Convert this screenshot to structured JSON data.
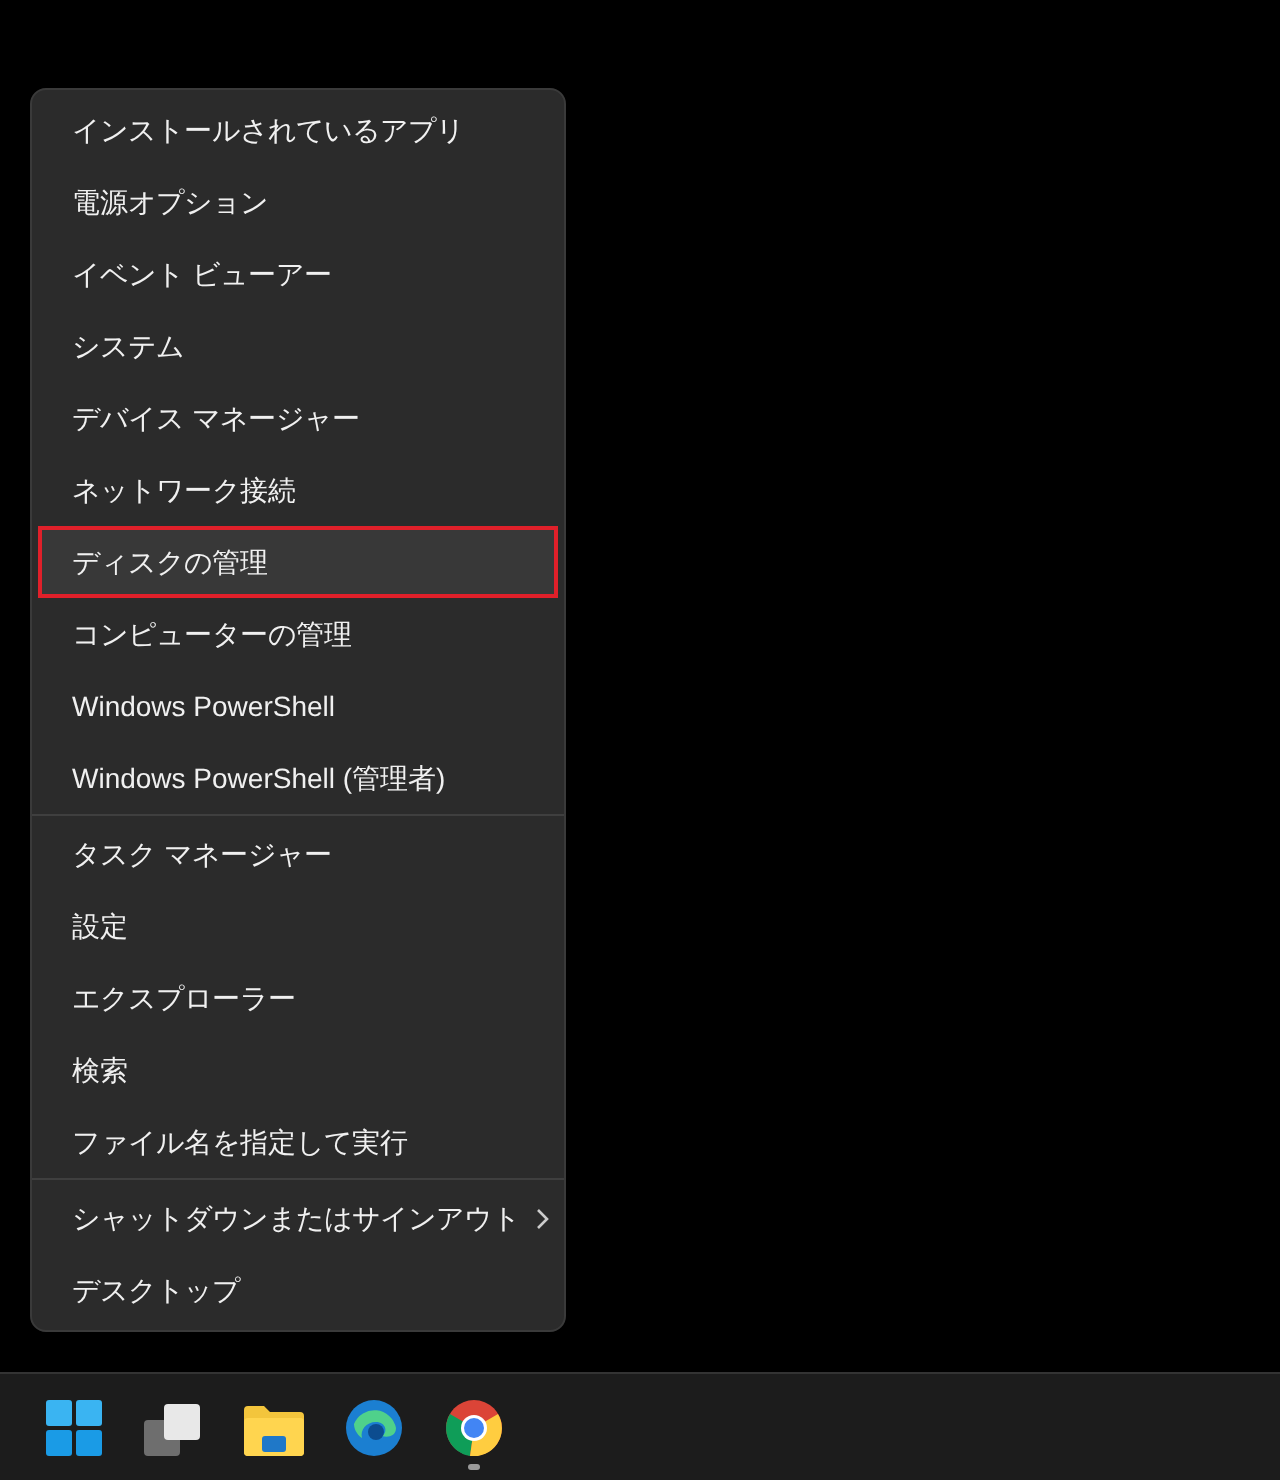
{
  "menu": {
    "sections": [
      {
        "items": [
          {
            "label": "インストールされているアプリ",
            "kind": "action",
            "selected": false
          },
          {
            "label": "電源オプション",
            "kind": "action",
            "selected": false
          },
          {
            "label": "イベント ビューアー",
            "kind": "action",
            "selected": false
          },
          {
            "label": "システム",
            "kind": "action",
            "selected": false
          },
          {
            "label": "デバイス マネージャー",
            "kind": "action",
            "selected": false
          },
          {
            "label": "ネットワーク接続",
            "kind": "action",
            "selected": false
          },
          {
            "label": "ディスクの管理",
            "kind": "action",
            "selected": true
          },
          {
            "label": "コンピューターの管理",
            "kind": "action",
            "selected": false
          },
          {
            "label": "Windows PowerShell",
            "kind": "action",
            "selected": false
          },
          {
            "label": "Windows PowerShell (管理者)",
            "kind": "action",
            "selected": false
          }
        ]
      },
      {
        "items": [
          {
            "label": "タスク マネージャー",
            "kind": "action",
            "selected": false
          },
          {
            "label": "設定",
            "kind": "action",
            "selected": false
          },
          {
            "label": "エクスプローラー",
            "kind": "action",
            "selected": false
          },
          {
            "label": "検索",
            "kind": "action",
            "selected": false
          },
          {
            "label": "ファイル名を指定して実行",
            "kind": "action",
            "selected": false
          }
        ]
      },
      {
        "items": [
          {
            "label": "シャットダウンまたはサインアウト",
            "kind": "submenu",
            "selected": false
          },
          {
            "label": "デスクトップ",
            "kind": "action",
            "selected": false
          }
        ]
      }
    ]
  },
  "taskbar": {
    "icons": [
      {
        "kind": "start",
        "running": false
      },
      {
        "kind": "task-view",
        "running": false
      },
      {
        "kind": "folder",
        "running": false
      },
      {
        "kind": "edge",
        "running": false
      },
      {
        "kind": "chrome",
        "running": true
      }
    ]
  }
}
